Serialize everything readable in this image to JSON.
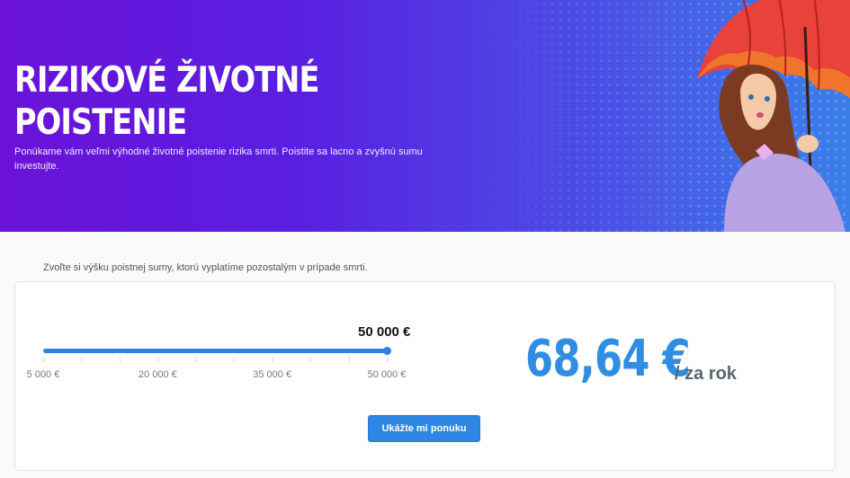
{
  "hero": {
    "title_line1": "RIZIKOVÉ ŽIVOTNÉ",
    "title_line2": "POISTENIE",
    "subtitle": "Ponúkame vám veľmi výhodné životné poistenie rizika smrti. Poistite sa lacno a zvyšnú sumu investujte.",
    "illustration": "woman-with-umbrella-illustration"
  },
  "calculator": {
    "hint": "Zvoľte si výšku poistnej sumy, ktorú vyplatíme pozostalým v prípade smrti.",
    "slider": {
      "value_label": "50 000 €",
      "value_fraction": 1.0,
      "tick_labels": [
        "5 000 €",
        "20 000 €",
        "35 000 €",
        "50 000 €"
      ],
      "minor_tick_count": 10
    },
    "price": "68,64 €",
    "price_period": "/ za rok",
    "cta_label": "Ukážte mi ponuku"
  },
  "colors": {
    "hero_start": "#6a12d8",
    "hero_end": "#3b7fe8",
    "accent": "#2f80e0",
    "price": "#2f8de4"
  }
}
